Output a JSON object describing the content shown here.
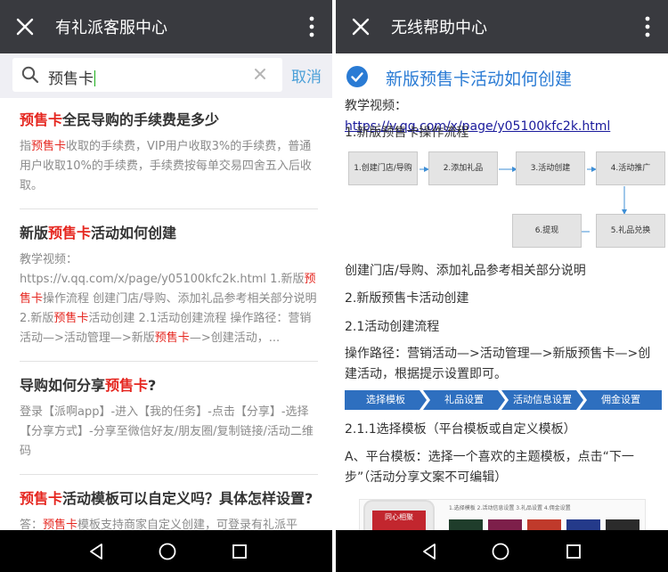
{
  "left": {
    "title": "有礼派客服中心",
    "search": {
      "value": "预售卡",
      "cancel_label": "取消"
    },
    "results": [
      {
        "title_hl": "预售卡",
        "title_rest": "全民导购的手续费是多少",
        "body": [
          {
            "t": "指",
            "h": false
          },
          {
            "t": "预售卡",
            "h": true
          },
          {
            "t": "收取的手续费，VIP用户收取3%的手续费，普通用户收取10%的手续费，手续费按每单交易四舍五入后收取。",
            "h": false
          }
        ]
      },
      {
        "title_pre": "新版",
        "title_hl": "预售卡",
        "title_rest": "活动如何创建",
        "body": [
          {
            "t": "教学视频：https://v.qq.com/x/page/y05100kfc2k.html 1.新版",
            "h": false
          },
          {
            "t": "预售卡",
            "h": true
          },
          {
            "t": "操作流程 创建门店/导购、添加礼品参考相关部分说明 2.新版",
            "h": false
          },
          {
            "t": "预售卡",
            "h": true
          },
          {
            "t": "活动创建 2.1活动创建流程 操作路径：营销活动—>活动管理—>新版",
            "h": false
          },
          {
            "t": "预售卡",
            "h": true
          },
          {
            "t": "—>创建活动，...",
            "h": false
          }
        ]
      },
      {
        "title_pre": "导购如何分享",
        "title_hl": "预售卡",
        "title_rest": "?",
        "body": [
          {
            "t": "登录【派啊app】-进入【我的任务】-点击【分享】-选择【分享方式】-分享至微信好友/朋友圈/复制链接/活动二维码",
            "h": false
          }
        ]
      },
      {
        "title_hl": "预售卡",
        "title_rest": "活动模板可以自定义吗？具体怎样设置?",
        "body": [
          {
            "t": "答：",
            "h": false
          },
          {
            "t": "预售卡",
            "h": true
          },
          {
            "t": "模板支持商家自定义创建，可登录有礼派平",
            "h": false
          }
        ]
      }
    ]
  },
  "right": {
    "title": "无线帮助中心",
    "article_title": "新版预售卡活动如何创建",
    "video_label": "教学视频：",
    "video_link": "https://v.qq.com/x/page/y05100kfc2k.html",
    "section1": "1.新版预售卡操作流程",
    "flow": [
      "1.创建门店/导购",
      "2.添加礼品",
      "3.活动创建",
      "4.活动推广",
      "5.礼品兑换",
      "6.提现"
    ],
    "note": "创建门店/导购、添加礼品参考相关部分说明",
    "section2": "2.新版预售卡活动创建",
    "section21": "2.1活动创建流程",
    "path": "操作路径：营销活动—>活动管理—>新版预售卡—>创建活动，根据提示设置即可。",
    "steps": [
      "选择模板",
      "礼品设置",
      "活动信息设置",
      "佣金设置"
    ],
    "section211": "2.1.1选择模板（平台模板或自定义模板）",
    "template_desc": "A、平台模板：选择一个喜欢的主题模板，点击“下一步”（活动分享文案不可编辑）",
    "screenshot": {
      "banner": "同心相聚",
      "tabs": "1.选择模板  2.活动信息设置  3.礼品设置  4.佣金设置"
    }
  },
  "colors": {
    "titlebar": "#393a3f",
    "highlight": "#e5261f",
    "link": "#2a7bd4",
    "step": "#2e6fbf"
  },
  "icons": [
    "close-icon",
    "more-icon",
    "search-icon",
    "clear-icon",
    "check-icon",
    "back-icon",
    "home-icon",
    "recents-icon"
  ]
}
